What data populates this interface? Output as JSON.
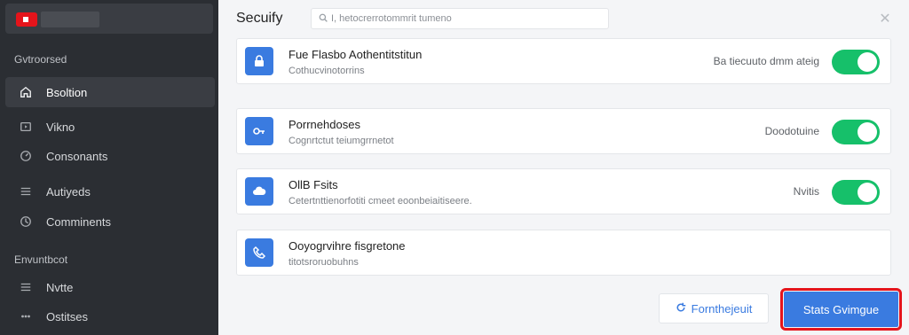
{
  "sidebar": {
    "brand": {
      "logo_icon": "play-logo-icon"
    },
    "section1_label": "Gvtroorsed",
    "section2_label": "Envuntbcot",
    "items": [
      {
        "label": "Bsoltion",
        "icon": "home-icon",
        "active": true
      },
      {
        "label": "Vikno",
        "icon": "video-icon",
        "active": false
      },
      {
        "label": "Consonants",
        "icon": "gauge-icon",
        "active": false
      },
      {
        "label": "Autiyeds",
        "icon": "list-icon",
        "active": false
      },
      {
        "label": "Comminents",
        "icon": "grid-icon",
        "active": false
      },
      {
        "label": "Nvtte",
        "icon": "list-icon",
        "active": false
      },
      {
        "label": "Ostitses",
        "icon": "dots-icon",
        "active": false
      }
    ]
  },
  "main": {
    "title": "Secuify",
    "search": {
      "placeholder": "I, hetocrerrotommrit tumeno",
      "value": ""
    },
    "close_icon": "close-icon",
    "cards": [
      {
        "icon": "lock-icon",
        "title": "Fue Flasbo Aothentitstitun",
        "subtitle": "Cothucvinotorrins",
        "status": "Ba tiecuuto dmm ateig",
        "toggle": true
      },
      {
        "icon": "key-icon",
        "title": "Porrnehdoses",
        "subtitle": "Cognrtctut teiumgrrnetot",
        "status": "Doodotuine",
        "toggle": true
      },
      {
        "icon": "cloud-icon",
        "title": "OllB Fsits",
        "subtitle": "Cetertnttienorfotiti cmeet eoonbeiaitiseere.",
        "status": "Nvitis",
        "toggle": true
      },
      {
        "icon": "phone-icon",
        "title": "Ooyogrvihre fisgretone",
        "subtitle": "titotsroruobuhns",
        "status": "",
        "toggle": false
      }
    ],
    "secondary_button": {
      "label": "Fornthejeuit",
      "icon": "refresh-icon"
    },
    "primary_button": {
      "label": "Stats Gvimgue"
    }
  },
  "colors": {
    "accent": "#3a7be0",
    "toggle_on": "#16c06a",
    "brand": "#e5141b",
    "sidebar_bg": "#2b2e33",
    "highlight": "#e5141b"
  }
}
